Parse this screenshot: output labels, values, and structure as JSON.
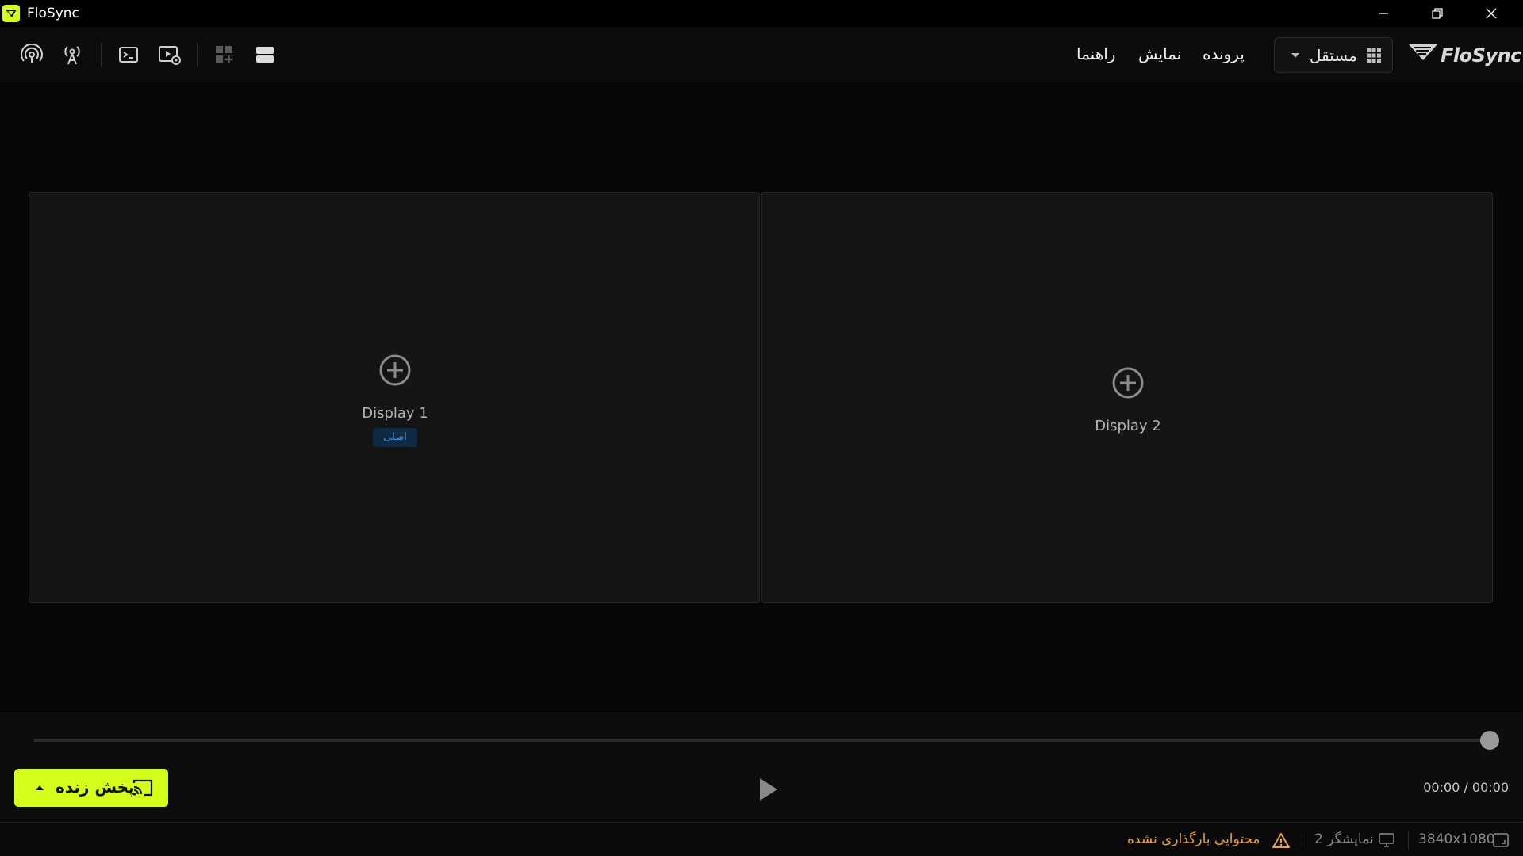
{
  "window": {
    "title": "FloSync"
  },
  "toolbar": {
    "menu": [
      {
        "id": "file",
        "label": "پرونده"
      },
      {
        "id": "view",
        "label": "نمایش"
      },
      {
        "id": "help",
        "label": "راهنما"
      }
    ],
    "mode": {
      "label": "مستقل"
    },
    "logo_text": "FloSync",
    "icons": [
      "broadcast-icon",
      "antenna-icon",
      "terminal-icon",
      "media-settings-icon",
      "add-layout-icon",
      "stacked-layout-icon"
    ]
  },
  "displays": [
    {
      "label": "Display 1",
      "badge": "اصلی"
    },
    {
      "label": "Display 2"
    }
  ],
  "playback": {
    "live_label": "پخش زنده",
    "time": "00:00 / 00:00",
    "progress": 1.0
  },
  "status": {
    "resolution": "3840x1080",
    "displays_count": "2 نمایشگر",
    "warning": "محتوایی بارگذاری نشده"
  },
  "colors": {
    "accent": "#d4ff1a",
    "warning": "#e9a13b",
    "badge_text": "#3c92d8"
  }
}
